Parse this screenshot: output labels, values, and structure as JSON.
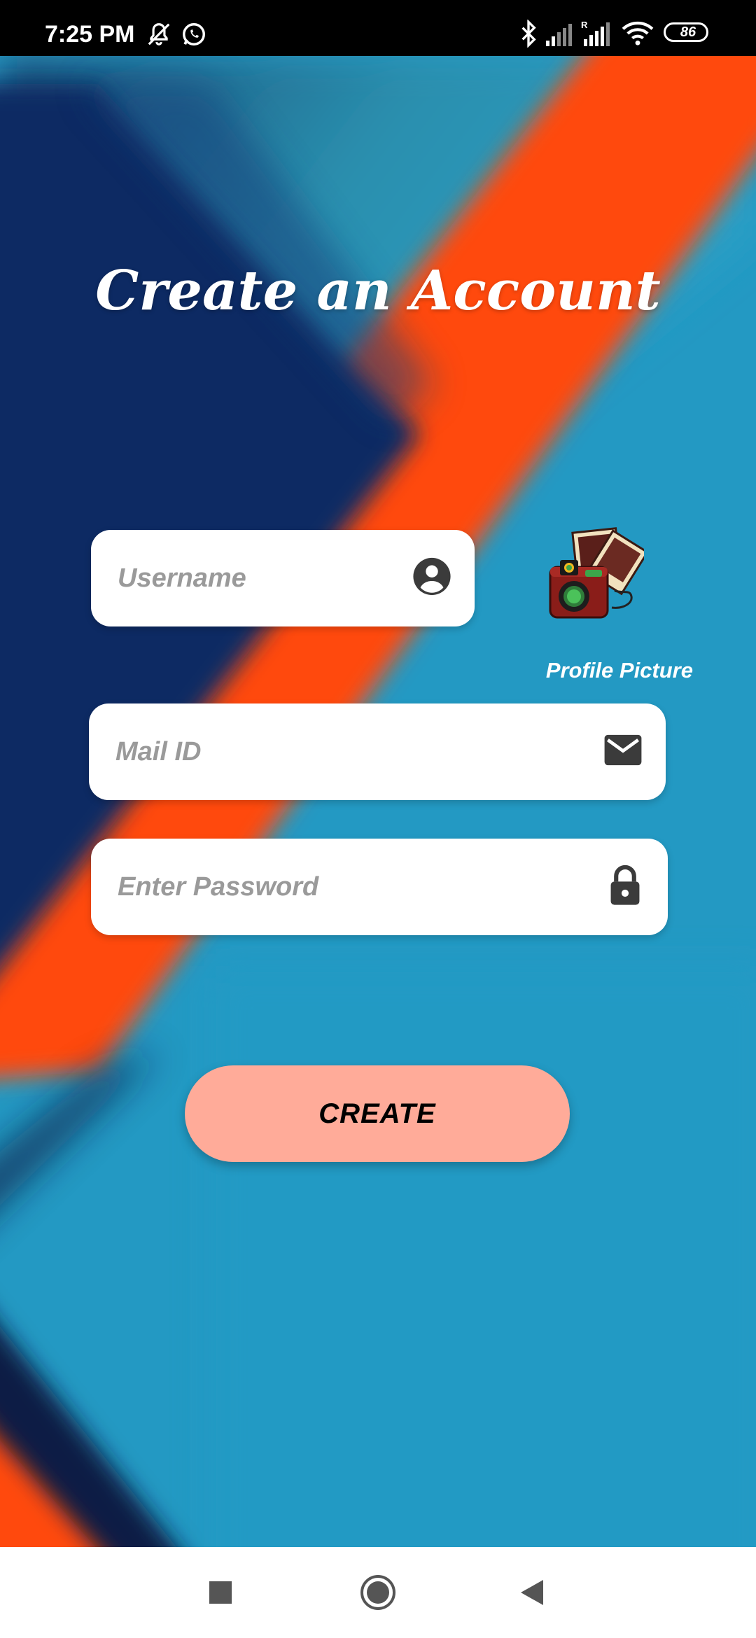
{
  "status_bar": {
    "time": "7:25 PM",
    "icons": [
      "mute-icon",
      "whatsapp-icon",
      "bluetooth-icon",
      "signal-icon",
      "signal-roaming-icon",
      "wifi-icon"
    ],
    "battery_level": "86"
  },
  "title": "Create an Account",
  "form": {
    "username_placeholder": "Username",
    "mail_placeholder": "Mail ID",
    "password_placeholder": "Enter Password",
    "profile_label": "Profile Picture",
    "create_label": "CREATE"
  },
  "nav_bar": {
    "buttons": [
      "recents-square",
      "home-circle",
      "back-triangle"
    ]
  },
  "colors": {
    "button": "#ffab99",
    "bg_blue": "#2399c3",
    "bg_navy": "#0b2a63",
    "bg_orange": "#ff4a0d"
  }
}
